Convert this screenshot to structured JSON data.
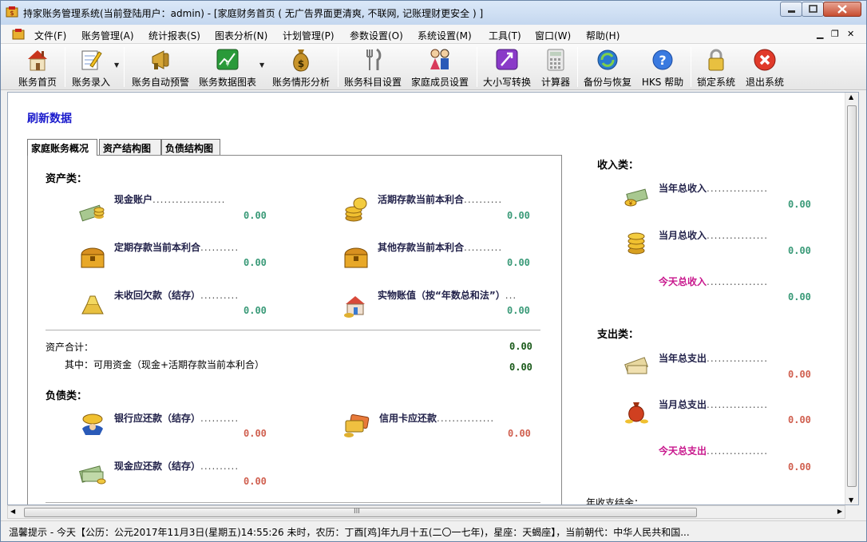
{
  "window": {
    "title": "持家账务管理系统(当前登陆用户：admin) - [家庭财务首页 ( 无广告界面更清爽, 不联网, 记账理财更安全 ) ]"
  },
  "menu": [
    "文件(F)",
    "账务管理(A)",
    "统计报表(S)",
    "图表分析(N)",
    "计划管理(P)",
    "参数设置(O)",
    "系统设置(M)",
    "工具(T)",
    "窗口(W)",
    "帮助(H)"
  ],
  "toolbar": [
    {
      "label": "账务首页",
      "icon": "house-icon"
    },
    {
      "label": "账务录入",
      "icon": "notepad-pencil-icon"
    },
    {
      "label": "账务自动预警",
      "icon": "megaphone-icon"
    },
    {
      "label": "账务数据图表",
      "icon": "stock-chart-icon"
    },
    {
      "label": "账务情形分析",
      "icon": "money-bag-icon"
    },
    {
      "label": "账务科目设置",
      "icon": "fork-knife-icon"
    },
    {
      "label": "家庭成员设置",
      "icon": "family-icon"
    },
    {
      "label": "大小写转换",
      "icon": "case-convert-icon"
    },
    {
      "label": "计算器",
      "icon": "calculator-icon"
    },
    {
      "label": "备份与恢复",
      "icon": "backup-icon"
    },
    {
      "label": "HKS 帮助",
      "icon": "help-icon"
    },
    {
      "label": "锁定系统",
      "icon": "lock-icon"
    },
    {
      "label": "退出系统",
      "icon": "exit-icon"
    }
  ],
  "content": {
    "refresh": "刷新数据",
    "tabs": [
      "家庭账务概况",
      "资产结构图",
      "负债结构图"
    ],
    "assets": {
      "heading": "资产类：",
      "cash": {
        "label": "现金账户",
        "value": "0.00"
      },
      "demand": {
        "label": "活期存款当前本利合",
        "value": "0.00"
      },
      "fixed": {
        "label": "定期存款当前本利合",
        "value": "0.00"
      },
      "other": {
        "label": "其他存款当前本利合",
        "value": "0.00"
      },
      "receivable": {
        "label": "未收回欠款（结存）",
        "value": "0.00"
      },
      "physical": {
        "label": "实物账值（按“年数总和法”）",
        "value": "0.00"
      }
    },
    "asset_total": {
      "label": "资产合计：",
      "value": "0.00"
    },
    "available": {
      "label": "其中：可用资金（现金+活期存款当前本利合）",
      "value": "0.00"
    },
    "liabilities": {
      "heading": "负债类：",
      "bank": {
        "label": "银行应还款（结存）",
        "value": "0.00"
      },
      "credit": {
        "label": "信用卡应还款",
        "value": "0.00"
      },
      "cash": {
        "label": "现金应还款（结存）",
        "value": "0.00"
      }
    },
    "income": {
      "heading": "收入类：",
      "year": {
        "label": "当年总收入",
        "value": "0.00"
      },
      "month": {
        "label": "当月总收入",
        "value": "0.00"
      },
      "today": {
        "label": "今天总收入",
        "value": "0.00"
      }
    },
    "expense": {
      "heading": "支出类：",
      "year": {
        "label": "当年总支出",
        "value": "0.00"
      },
      "month": {
        "label": "当月总支出",
        "value": "0.00"
      },
      "today": {
        "label": "今天总支出",
        "value": "0.00"
      }
    },
    "year_balance": "年收支结余："
  },
  "scrollbar": {
    "hgrip": "III"
  },
  "status": "温馨提示 - 今天【公历：公元2017年11月3日(星期五)14:55:26 未时，农历：丁酉[鸡]年九月十五(二〇一七年)，星座：天蝎座】，当前朝代：中华人民共和国..."
}
